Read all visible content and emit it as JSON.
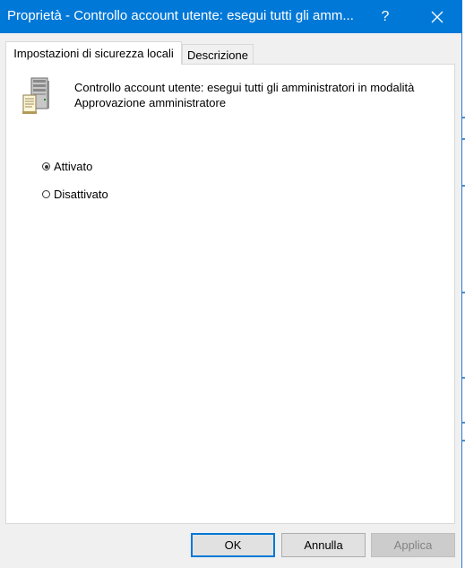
{
  "window": {
    "title": "Proprietà - Controllo account utente: esegui tutti gli amm...",
    "help_label": "?",
    "accent": "#0078d7"
  },
  "tabs": [
    {
      "label": "Impostazioni di sicurezza locali",
      "active": true
    },
    {
      "label": "Descrizione",
      "active": false
    }
  ],
  "policy": {
    "icon": "server-policy-icon",
    "description_line1": "Controllo account utente: esegui tutti gli amministratori in modalità",
    "description_line2": "Approvazione amministratore"
  },
  "options": [
    {
      "label": "Attivato",
      "checked": true
    },
    {
      "label": "Disattivato",
      "checked": false
    }
  ],
  "buttons": {
    "ok": "OK",
    "cancel": "Annulla",
    "apply": "Applica"
  }
}
